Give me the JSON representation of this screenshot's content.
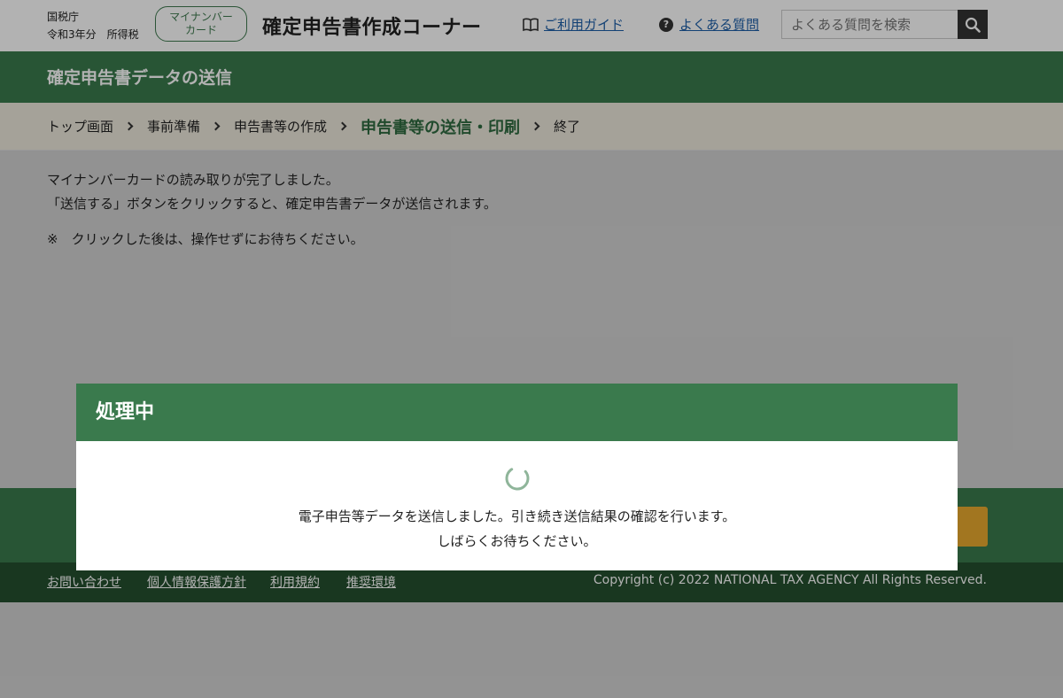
{
  "header": {
    "agency_line1": "国税庁",
    "agency_line2": "令和3年分　所得税",
    "mynumber_badge_line1": "マイナンバー",
    "mynumber_badge_line2": "カード",
    "site_title": "確定申告書作成コーナー",
    "guide_link": "ご利用ガイド",
    "faq_link": "よくある質問",
    "faq_icon_text": "?",
    "search_placeholder": "よくある質問を検索"
  },
  "title_band": {
    "title": "確定申告書データの送信"
  },
  "breadcrumb": {
    "items": [
      "トップ画面",
      "事前準備",
      "申告書等の作成",
      "申告書等の送信・印刷",
      "終了"
    ],
    "current_index": 3
  },
  "content": {
    "line1": "マイナンバーカードの読み取りが完了しました。",
    "line2": "「送信する」ボタンをクリックすると、確定申告書データが送信されます。",
    "note": "※　クリックした後は、操作せずにお待ちください。"
  },
  "footer": {
    "links": [
      "お問い合わせ",
      "個人情報保護方針",
      "利用規約",
      "推奨環境"
    ],
    "copyright": "Copyright (c) 2022 NATIONAL TAX AGENCY All Rights Reserved."
  },
  "modal": {
    "title": "処理中",
    "message_line1": "電子申告等データを送信しました。引き続き送信結果の確認を行います。",
    "message_line2": "しばらくお待ちください。"
  },
  "icons": {
    "guide": "book-icon",
    "faq": "question-circle-icon",
    "search": "magnifier-icon",
    "breadcrumb_separator": "chevron-right-icon",
    "loading": "spinner-icon"
  },
  "colors": {
    "brand_green": "#3a7a4d",
    "footer_green": "#24502f",
    "link_blue": "#1e5fa8",
    "send_button": "#e8a92f",
    "breadcrumb_bg": "#ece8dc"
  }
}
